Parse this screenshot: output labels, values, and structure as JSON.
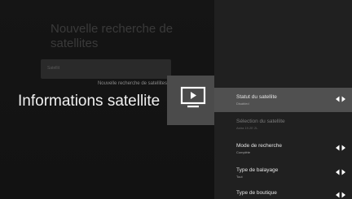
{
  "background": {
    "title": "Nouvelle recherche de satellites",
    "input_placeholder": "Satellit",
    "caption": "Nouvelle recherche de satellites"
  },
  "page_title": "Informations satellite",
  "icon": "tv-play-icon",
  "menu": {
    "items": [
      {
        "label": "Statut du satellite",
        "value": "Disabled",
        "selected": true,
        "arrows": true
      },
      {
        "label": "Sélection du satellite",
        "value": "Astra 19.2E 2L",
        "selected": false,
        "dim": true,
        "arrows": false
      },
      {
        "label": "Mode de recherche",
        "value": "Complète",
        "selected": false,
        "arrows": true
      },
      {
        "label": "Type de balayage",
        "value": "Tout",
        "selected": false,
        "arrows": true
      },
      {
        "label": "Type de boutique",
        "value": "",
        "selected": false,
        "arrows": true
      }
    ]
  },
  "colors": {
    "selected": "#505050",
    "panel": "#202020",
    "tile": "#4b4b4b"
  }
}
